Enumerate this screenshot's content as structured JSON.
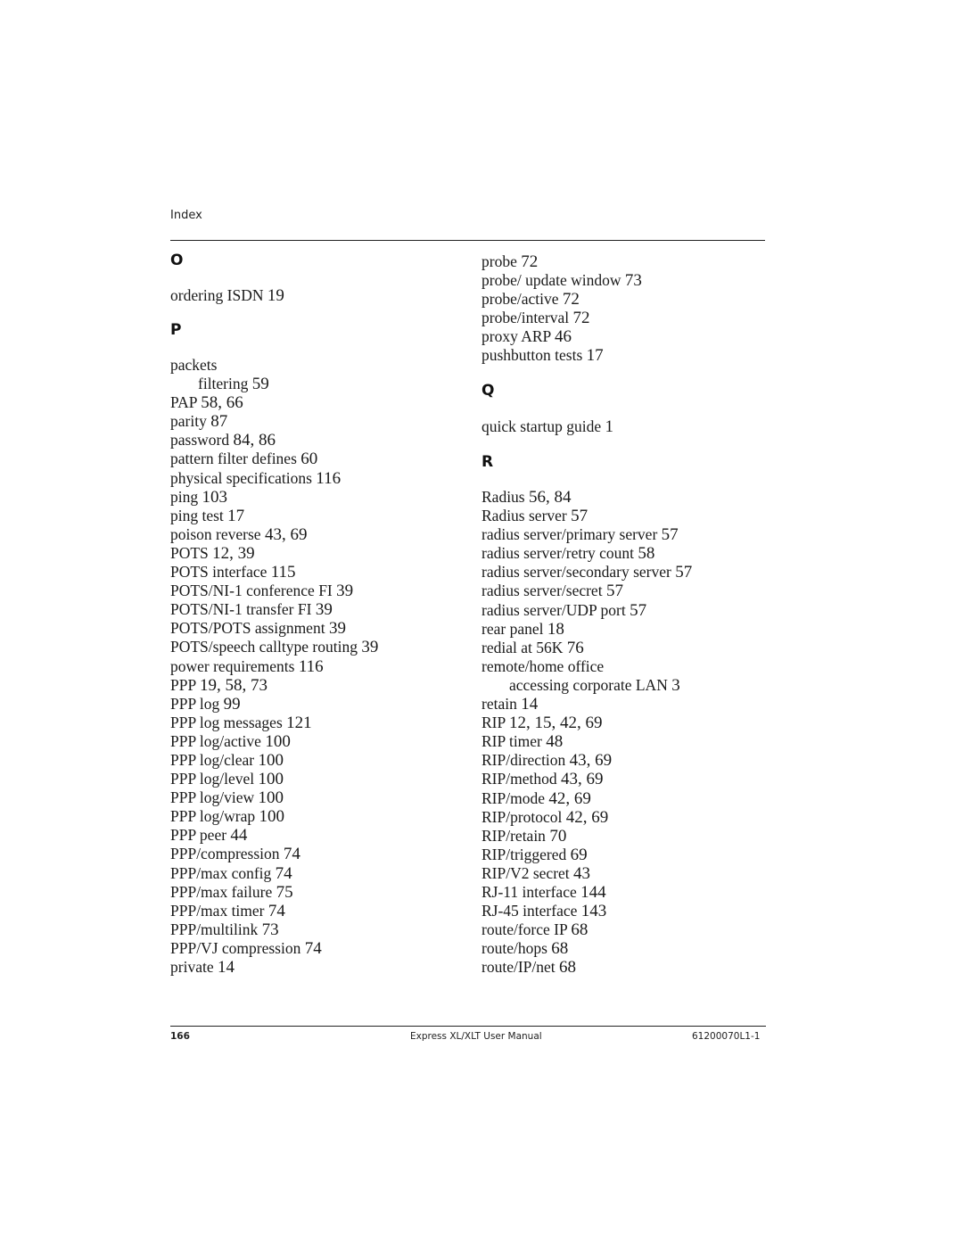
{
  "header": {
    "running_head": "Index"
  },
  "left_column": {
    "sections": [
      {
        "letter": "O",
        "entries": [
          {
            "term": "ordering ISDN",
            "pages": "19",
            "sub": false
          }
        ]
      },
      {
        "letter": "P",
        "entries": [
          {
            "term": "packets",
            "pages": "",
            "sub": false
          },
          {
            "term": "filtering",
            "pages": "59",
            "sub": true
          },
          {
            "term": "PAP",
            "pages": "58, 66",
            "sub": false
          },
          {
            "term": "parity",
            "pages": "87",
            "sub": false
          },
          {
            "term": "password",
            "pages": "84, 86",
            "sub": false
          },
          {
            "term": "pattern filter defines",
            "pages": "60",
            "sub": false
          },
          {
            "term": "physical specifications",
            "pages": "116",
            "sub": false
          },
          {
            "term": "ping",
            "pages": "103",
            "sub": false
          },
          {
            "term": "ping test",
            "pages": "17",
            "sub": false
          },
          {
            "term": "poison reverse",
            "pages": "43, 69",
            "sub": false
          },
          {
            "term": "POTS",
            "pages": "12, 39",
            "sub": false
          },
          {
            "term": "POTS interface",
            "pages": "115",
            "sub": false
          },
          {
            "term": "POTS/NI-1 conference FI",
            "pages": "39",
            "sub": false
          },
          {
            "term": "POTS/NI-1 transfer FI",
            "pages": "39",
            "sub": false
          },
          {
            "term": "POTS/POTS assignment",
            "pages": "39",
            "sub": false
          },
          {
            "term": "POTS/speech calltype routing",
            "pages": "39",
            "sub": false
          },
          {
            "term": "power requirements",
            "pages": "116",
            "sub": false
          },
          {
            "term": "PPP",
            "pages": "19, 58, 73",
            "sub": false
          },
          {
            "term": "PPP log",
            "pages": "99",
            "sub": false
          },
          {
            "term": "PPP log messages",
            "pages": "121",
            "sub": false
          },
          {
            "term": "PPP log/active",
            "pages": "100",
            "sub": false
          },
          {
            "term": "PPP log/clear",
            "pages": "100",
            "sub": false
          },
          {
            "term": "PPP log/level",
            "pages": "100",
            "sub": false
          },
          {
            "term": "PPP log/view",
            "pages": "100",
            "sub": false
          },
          {
            "term": "PPP log/wrap",
            "pages": "100",
            "sub": false
          },
          {
            "term": "PPP peer",
            "pages": "44",
            "sub": false
          },
          {
            "term": "PPP/compression",
            "pages": "74",
            "sub": false
          },
          {
            "term": "PPP/max config",
            "pages": "74",
            "sub": false
          },
          {
            "term": "PPP/max failure",
            "pages": "75",
            "sub": false
          },
          {
            "term": "PPP/max timer",
            "pages": "74",
            "sub": false
          },
          {
            "term": "PPP/multilink",
            "pages": "73",
            "sub": false
          },
          {
            "term": "PPP/VJ compression",
            "pages": "74",
            "sub": false
          },
          {
            "term": "private",
            "pages": "14",
            "sub": false
          }
        ]
      }
    ]
  },
  "right_column": {
    "sections": [
      {
        "letter": "",
        "entries": [
          {
            "term": "probe",
            "pages": "72",
            "sub": false
          },
          {
            "term": "probe/ update window",
            "pages": "73",
            "sub": false
          },
          {
            "term": "probe/active",
            "pages": "72",
            "sub": false
          },
          {
            "term": "probe/interval",
            "pages": "72",
            "sub": false
          },
          {
            "term": "proxy ARP",
            "pages": "46",
            "sub": false
          },
          {
            "term": "pushbutton tests",
            "pages": "17",
            "sub": false
          }
        ]
      },
      {
        "letter": "Q",
        "entries": [
          {
            "term": "quick startup guide",
            "pages": "1",
            "sub": false
          }
        ]
      },
      {
        "letter": "R",
        "entries": [
          {
            "term": "Radius",
            "pages": "56, 84",
            "sub": false
          },
          {
            "term": "Radius server",
            "pages": "57",
            "sub": false
          },
          {
            "term": "radius server/primary server",
            "pages": "57",
            "sub": false
          },
          {
            "term": "radius server/retry count",
            "pages": "58",
            "sub": false
          },
          {
            "term": "radius server/secondary server",
            "pages": "57",
            "sub": false
          },
          {
            "term": "radius server/secret",
            "pages": "57",
            "sub": false
          },
          {
            "term": "radius server/UDP port",
            "pages": "57",
            "sub": false
          },
          {
            "term": "rear panel",
            "pages": "18",
            "sub": false
          },
          {
            "term": "redial at 56K",
            "pages": "76",
            "sub": false
          },
          {
            "term": "remote/home office",
            "pages": "",
            "sub": false
          },
          {
            "term": "accessing corporate LAN",
            "pages": "3",
            "sub": true
          },
          {
            "term": "retain",
            "pages": "14",
            "sub": false
          },
          {
            "term": "RIP",
            "pages": "12, 15, 42, 69",
            "sub": false
          },
          {
            "term": "RIP timer",
            "pages": "48",
            "sub": false
          },
          {
            "term": "RIP/direction",
            "pages": "43, 69",
            "sub": false
          },
          {
            "term": "RIP/method",
            "pages": "43, 69",
            "sub": false
          },
          {
            "term": "RIP/mode",
            "pages": "42, 69",
            "sub": false
          },
          {
            "term": "RIP/protocol",
            "pages": "42, 69",
            "sub": false
          },
          {
            "term": "RIP/retain",
            "pages": "70",
            "sub": false
          },
          {
            "term": "RIP/triggered",
            "pages": "69",
            "sub": false
          },
          {
            "term": "RIP/V2 secret",
            "pages": "43",
            "sub": false
          },
          {
            "term": "RJ-11 interface",
            "pages": "144",
            "sub": false
          },
          {
            "term": "RJ-45 interface",
            "pages": "143",
            "sub": false
          },
          {
            "term": "route/force IP",
            "pages": "68",
            "sub": false
          },
          {
            "term": "route/hops",
            "pages": "68",
            "sub": false
          },
          {
            "term": "route/IP/net",
            "pages": "68",
            "sub": false
          }
        ]
      }
    ]
  },
  "footer": {
    "page_number": "166",
    "manual_title": "Express XL/XLT User Manual",
    "document_number": "61200070L1-1"
  }
}
